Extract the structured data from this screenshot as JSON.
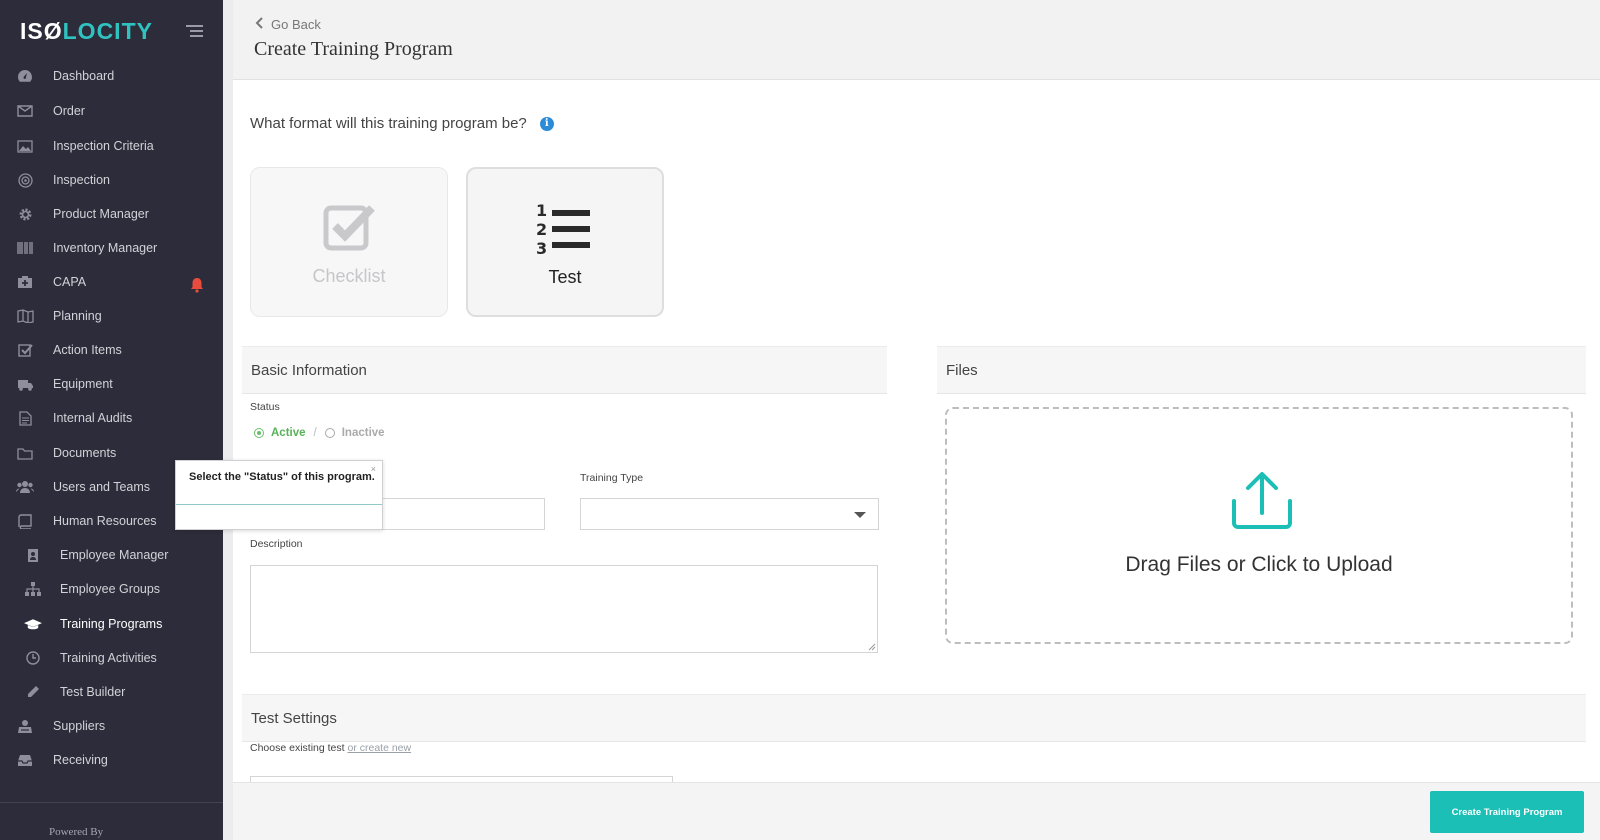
{
  "brand": {
    "part1": "ISØ",
    "part2": "LOCITY"
  },
  "sidebar": {
    "items": [
      {
        "label": "Dashboard",
        "icon": "dashboard-icon"
      },
      {
        "label": "Order",
        "icon": "inbox-icon"
      },
      {
        "label": "Inspection Criteria",
        "icon": "image-icon"
      },
      {
        "label": "Inspection",
        "icon": "target-icon"
      },
      {
        "label": "Product Manager",
        "icon": "gear-icon"
      },
      {
        "label": "Inventory Manager",
        "icon": "barcode-icon"
      },
      {
        "label": "CAPA",
        "icon": "medkit-icon"
      },
      {
        "label": "Planning",
        "icon": "map-icon"
      },
      {
        "label": "Action Items",
        "icon": "check-square-icon"
      },
      {
        "label": "Equipment",
        "icon": "truck-icon"
      },
      {
        "label": "Internal Audits",
        "icon": "file-text-icon"
      },
      {
        "label": "Documents",
        "icon": "folder-icon"
      },
      {
        "label": "Users and Teams",
        "icon": "users-icon"
      },
      {
        "label": "Human Resources",
        "icon": "book-icon"
      },
      {
        "label": "Employee Manager",
        "icon": "id-badge-icon"
      },
      {
        "label": "Employee Groups",
        "icon": "sitemap-icon"
      },
      {
        "label": "Training Programs",
        "icon": "graduation-cap-icon"
      },
      {
        "label": "Training Activities",
        "icon": "clock-icon"
      },
      {
        "label": "Test Builder",
        "icon": "pencil-icon"
      },
      {
        "label": "Suppliers",
        "icon": "supplier-icon"
      },
      {
        "label": "Receiving",
        "icon": "tray-icon"
      }
    ],
    "powered_by": "Powered By"
  },
  "header": {
    "go_back": "Go Back",
    "title": "Create Training Program"
  },
  "format": {
    "question": "What format will this training program be?",
    "checklist_label": "Checklist",
    "test_label": "Test"
  },
  "basic_info": {
    "heading": "Basic Information",
    "status_label": "Status",
    "active": "Active",
    "separator": "/",
    "inactive": "Inactive",
    "training_type_label": "Training Type",
    "description_label": "Description"
  },
  "tooltip": {
    "text": "Select the \"Status\" of this program.",
    "close": "×"
  },
  "files": {
    "heading": "Files",
    "drop_text": "Drag Files or Click to Upload"
  },
  "test_settings": {
    "heading": "Test Settings",
    "choose_label": "Choose existing test",
    "create_new": "or create new"
  },
  "footer": {
    "create_button": "Create Training Program"
  },
  "colors": {
    "accent": "#1bbfb6",
    "sidebar_bg": "#2d2c3a",
    "active_green": "#58b158",
    "alert_red": "#e74c3c",
    "info_blue": "#2b8bd6"
  }
}
